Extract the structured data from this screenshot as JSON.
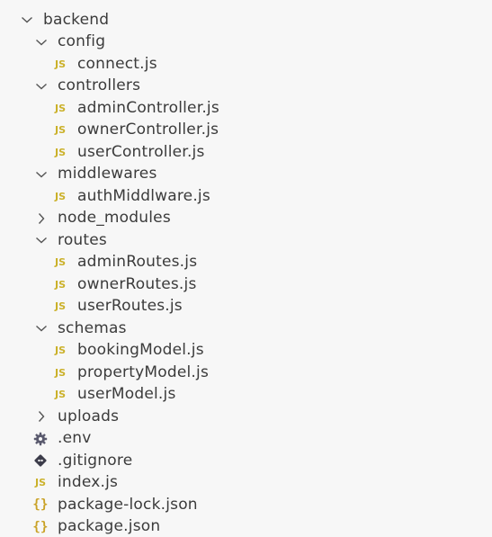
{
  "explorer": {
    "root": {
      "label": "backend",
      "expanded": true,
      "icon": "chevron-down-icon"
    },
    "config": {
      "label": "config",
      "expanded": true,
      "icon": "chevron-down-icon"
    },
    "config_files": [
      {
        "label": "connect.js",
        "icon": "js-file-icon",
        "badge": "JS"
      }
    ],
    "controllers": {
      "label": "controllers",
      "expanded": true,
      "icon": "chevron-down-icon"
    },
    "controllers_files": [
      {
        "label": "adminController.js",
        "icon": "js-file-icon",
        "badge": "JS"
      },
      {
        "label": "ownerController.js",
        "icon": "js-file-icon",
        "badge": "JS"
      },
      {
        "label": "userController.js",
        "icon": "js-file-icon",
        "badge": "JS"
      }
    ],
    "middlewares": {
      "label": "middlewares",
      "expanded": true,
      "icon": "chevron-down-icon"
    },
    "middlewares_files": [
      {
        "label": "authMiddlware.js",
        "icon": "js-file-icon",
        "badge": "JS"
      }
    ],
    "node_modules": {
      "label": "node_modules",
      "expanded": false,
      "icon": "chevron-right-icon"
    },
    "routes": {
      "label": "routes",
      "expanded": true,
      "icon": "chevron-down-icon"
    },
    "routes_files": [
      {
        "label": "adminRoutes.js",
        "icon": "js-file-icon",
        "badge": "JS"
      },
      {
        "label": "ownerRoutes.js",
        "icon": "js-file-icon",
        "badge": "JS"
      },
      {
        "label": "userRoutes.js",
        "icon": "js-file-icon",
        "badge": "JS"
      }
    ],
    "schemas": {
      "label": "schemas",
      "expanded": true,
      "icon": "chevron-down-icon"
    },
    "schemas_files": [
      {
        "label": "bookingModel.js",
        "icon": "js-file-icon",
        "badge": "JS"
      },
      {
        "label": "propertyModel.js",
        "icon": "js-file-icon",
        "badge": "JS"
      },
      {
        "label": "userModel.js",
        "icon": "js-file-icon",
        "badge": "JS"
      }
    ],
    "uploads": {
      "label": "uploads",
      "expanded": false,
      "icon": "chevron-right-icon"
    },
    "root_files": [
      {
        "label": ".env",
        "icon": "gear-icon"
      },
      {
        "label": ".gitignore",
        "icon": "git-icon"
      },
      {
        "label": "index.js",
        "icon": "js-file-icon",
        "badge": "JS"
      },
      {
        "label": "package-lock.json",
        "icon": "json-file-icon",
        "badge": "{}"
      },
      {
        "label": "package.json",
        "icon": "json-file-icon",
        "badge": "{}"
      }
    ]
  },
  "colors": {
    "background": "#f7f7f7",
    "text": "#3b3b3b",
    "chevron": "#555555",
    "js_icon": "#cbb12a",
    "json_icon": "#c9a227",
    "gear_icon": "#5a5a6e",
    "git_icon": "#3c3c4a"
  }
}
